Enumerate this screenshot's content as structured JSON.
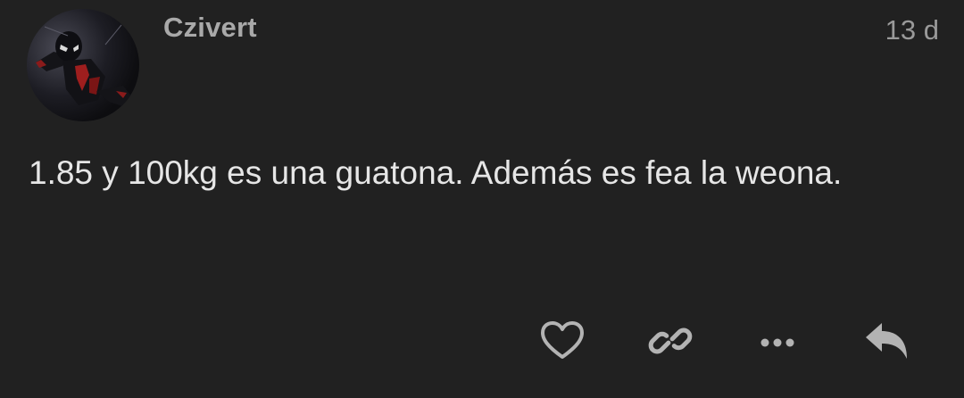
{
  "post": {
    "author": "Czivert",
    "age": "13 d",
    "text": "1.85 y 100kg es una guatona. Además es fea la weona."
  },
  "avatar": {
    "icon": "spiderman-avatar"
  },
  "actions": {
    "like_icon": "heart-icon",
    "link_icon": "link-icon",
    "more_icon": "more-horizontal-icon",
    "reply_icon": "reply-icon"
  },
  "colors": {
    "background": "#212121",
    "username": "#a9a9a9",
    "timestamp": "#9a9a9a",
    "text": "#e6e6e6",
    "icon": "#b3b3b3"
  }
}
